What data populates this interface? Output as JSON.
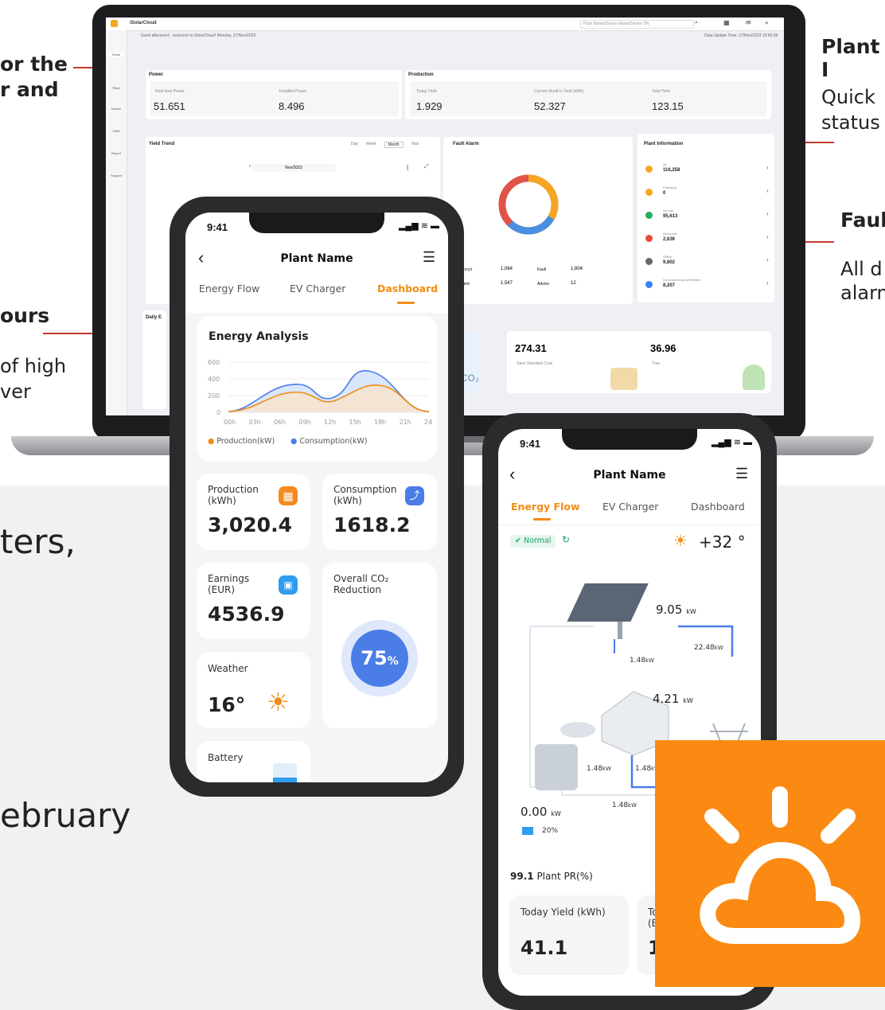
{
  "side_texts": {
    "left_top_1": "or the",
    "left_top_2": "r and",
    "left_mid": "ours",
    "left_mid_2": "of high",
    "left_mid_3": "ver",
    "right_top_title": "Plant I",
    "right_top_1": "Quick",
    "right_top_2": "status",
    "right_mid_title": "Fault",
    "right_mid_1": "All d",
    "right_mid_2": "alarm",
    "bottom_1": "ters,",
    "bottom_2": "ebruary"
  },
  "laptop": {
    "app_name": "iSolarCloud",
    "greeting": "Good afternoon! , welcome to iSolarCloud! Monday, 27/Nov/2023",
    "update_time": "Data Update Time: 27/Nov/2023 15:56:09",
    "search_placeholder": "Plant Name/Device Name/Device SN",
    "sidebar": [
      "Home",
      "Plant",
      "Device",
      "O&M",
      "Report",
      "Support"
    ],
    "power_title": "Power",
    "production_title": "Production",
    "metrics": [
      {
        "label": "Real-time Power",
        "value": "51.651"
      },
      {
        "label": "Installed Power",
        "value": "8.496"
      },
      {
        "label": "Today Yield",
        "value": "1.929"
      },
      {
        "label": "Current Month's Yield (kWh)",
        "value": "52.327"
      },
      {
        "label": "Total Yield",
        "value": "123.15"
      }
    ],
    "yield_trend": "Yield Trend",
    "period_tabs": [
      "Day",
      "Week",
      "Month",
      "Year"
    ],
    "month": "Nov/2023",
    "fault_alarm": "Fault Alarm",
    "fault_stats": [
      {
        "label": "Prompt",
        "value": "1,064"
      },
      {
        "label": "Fault",
        "value": "1,804"
      },
      {
        "label": "Alarm",
        "value": "1,547"
      },
      {
        "label": "Advice",
        "value": "12"
      }
    ],
    "plant_info_title": "Plant Information",
    "plant_info": [
      {
        "label": "All",
        "value": "116,258",
        "color": "#f5a623"
      },
      {
        "label": "Following",
        "value": "0",
        "color": "#f5a623"
      },
      {
        "label": "Normal",
        "value": "95,613",
        "color": "#27ae60"
      },
      {
        "label": "Abnormal",
        "value": "2,636",
        "color": "#e74c3c"
      },
      {
        "label": "Offline",
        "value": "9,802",
        "color": "#666666"
      },
      {
        "label": "Commissioning Unfinished",
        "value": "8,207",
        "color": "#3b82f6"
      }
    ],
    "daily_title": "Daily E",
    "bottom_cards": [
      {
        "value": "274.31",
        "label": "Save Standard Coal"
      },
      {
        "value": "36.96",
        "label": "Tree"
      }
    ],
    "co2": "CO₂"
  },
  "phone1": {
    "time": "9:41",
    "title": "Plant Name",
    "tabs": [
      "Energy Flow",
      "EV Charger",
      "Dashboard"
    ],
    "active_tab": "Dashboard",
    "analysis_title": "Energy Analysis",
    "y_ticks": [
      "600",
      "400",
      "200",
      "0"
    ],
    "x_ticks": [
      "00h",
      "03h",
      "06h",
      "09h",
      "12h",
      "15h",
      "18h",
      "21h",
      "24h"
    ],
    "legend_production": "Production(kW)",
    "legend_consumption": "Consumption(kW)",
    "production_label": "Production\n(kWh)",
    "production_value": "3,020.4",
    "consumption_label": "Consumption\n(kWh)",
    "consumption_value": "1618.2",
    "earnings_label": "Earnings\n(EUR)",
    "earnings_value": "4536.9",
    "co2_label": "Overall CO₂\nReduction",
    "co2_value": "75",
    "co2_unit": "%",
    "weather_label": "Weather",
    "weather_value": "16°",
    "battery_label": "Battery"
  },
  "phone2": {
    "time": "9:41",
    "title": "Plant Name",
    "tabs": [
      "Energy Flow",
      "EV Charger",
      "Dashboard"
    ],
    "active_tab": "Energy Flow",
    "status": "Normal",
    "temperature": "+32 °",
    "pv_value": "9.05",
    "pv_unit": "kW",
    "grid_value": "22.48",
    "grid_unit": "kW",
    "link_value": "1.48",
    "link_unit": "kW",
    "house_value": "4.21",
    "house_unit": "kW",
    "battery_value": "0.00",
    "battery_unit": "kW",
    "battery_soc": "20%",
    "pr_value": "99.1",
    "pr_label": "Plant PR(%)",
    "today_yield_label": "Today Yield (kWh)",
    "today_yield_value": "41.1",
    "second_card_label": "To\n(E",
    "second_card_value": "1"
  }
}
